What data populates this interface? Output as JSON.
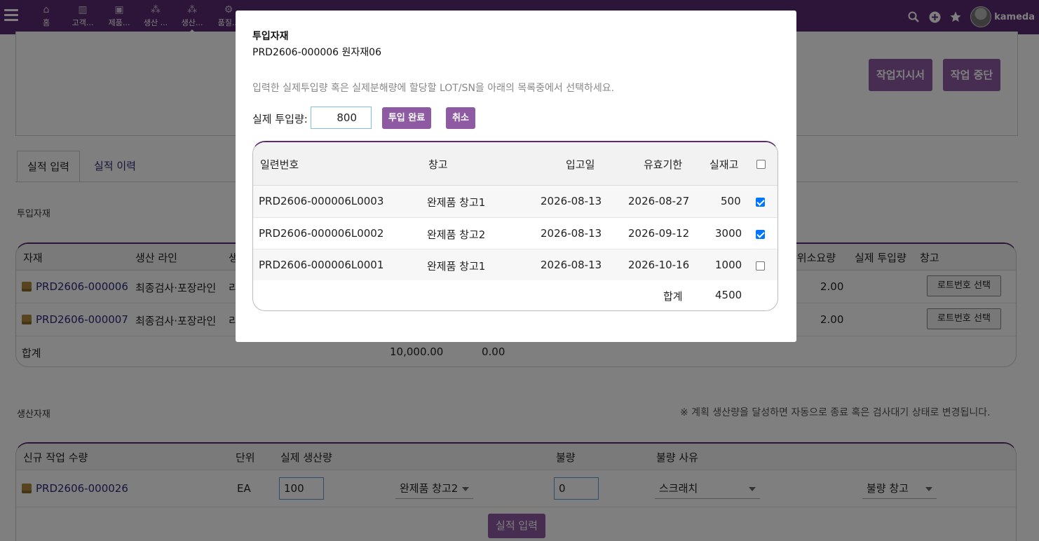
{
  "topbar": {
    "nav": [
      {
        "icon": "home-icon",
        "label": "홈"
      },
      {
        "icon": "building-icon",
        "label": "고객..."
      },
      {
        "icon": "box-icon",
        "label": "제품..."
      },
      {
        "icon": "boxes-icon",
        "label": "생산 ..."
      },
      {
        "icon": "boxes-icon",
        "label": "생산..."
      },
      {
        "icon": "gears-icon",
        "label": "품질..."
      }
    ],
    "username": "kameda"
  },
  "page": {
    "buttons": {
      "work_order": "작업지시서",
      "stop_work": "작업 중단"
    },
    "tabs": {
      "input": "실적 입력",
      "history": "실적 이력"
    },
    "input_section": {
      "title": "투입자재",
      "headers": {
        "material": "자재",
        "line": "생산 라인",
        "col3": "생",
        "unit_req": "단위소요량",
        "actual_input": "실제 투입량",
        "warehouse": "창고"
      },
      "rows": [
        {
          "material": "PRD2606-000006",
          "line": "최종검사·포장라인",
          "col3": "리",
          "unit_req": "2.00",
          "button": "로트번호 선택"
        },
        {
          "material": "PRD2606-000007",
          "line": "최종검사·포장라인",
          "col3": "리",
          "unit_req": "2.00",
          "button": "로트번호 선택"
        }
      ],
      "total": {
        "label": "합계",
        "v1": "10,000.00",
        "v2": "0.00"
      }
    },
    "output_section": {
      "title": "생산자재",
      "notice": "※ 계획 생산량을 달성하면 자동으로 종료 혹은 검사대기 상태로 변경됩니다.",
      "headers": {
        "new_qty": "신규 작업 수량",
        "unit": "단위",
        "actual": "실제 생산량",
        "defect": "불량",
        "reason": "불량 사유"
      },
      "row": {
        "item": "PRD2606-000026",
        "unit": "EA",
        "actual": "100",
        "warehouse": "완제품 창고2",
        "defect": "0",
        "reason": "스크래치",
        "defect_wh": "불량 창고"
      },
      "submit": "실적 입력"
    }
  },
  "modal": {
    "title": "투입자재",
    "subtitle": "PRD2606-000006 원자재06",
    "info": "입력한 실제투입량 혹은 실제분해량에 할당할 LOT/SN을 아래의 목록중에서 선택하세요.",
    "qty_label": "실제 투입량:",
    "qty_value": "800",
    "confirm_label": "투입 완료",
    "cancel_label": "취소",
    "columns": {
      "serial": "일련번호",
      "warehouse": "창고",
      "in_date": "입고일",
      "expiry": "유효기한",
      "stock": "실재고"
    },
    "rows": [
      {
        "serial": "PRD2606-000006L0003",
        "warehouse": "완제품 창고1",
        "in_date": "2026-08-13",
        "expiry": "2026-08-27",
        "stock": "500",
        "checked": true
      },
      {
        "serial": "PRD2606-000006L0002",
        "warehouse": "완제품 창고2",
        "in_date": "2026-08-13",
        "expiry": "2026-09-12",
        "stock": "3000",
        "checked": true
      },
      {
        "serial": "PRD2606-000006L0001",
        "warehouse": "완제품 창고1",
        "in_date": "2026-08-13",
        "expiry": "2026-10-16",
        "stock": "1000",
        "checked": false
      }
    ],
    "total_label": "합계",
    "total_value": "4500"
  }
}
